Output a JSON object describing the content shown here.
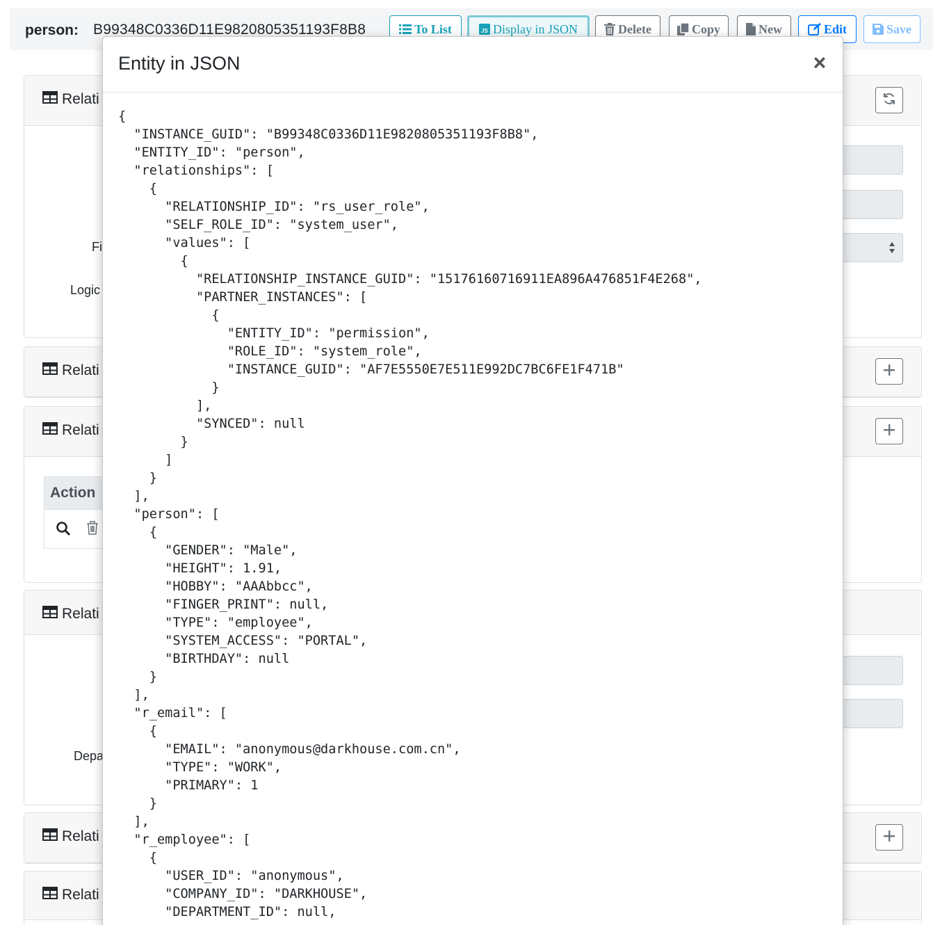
{
  "header": {
    "entity_label": "person:",
    "entity_guid": "B99348C0336D11E9820805351193F8B8",
    "buttons": {
      "to_list": "To List",
      "display_json": "Display in JSON",
      "delete": "Delete",
      "copy": "Copy",
      "new": "New",
      "edit": "Edit",
      "save": "Save"
    }
  },
  "background": {
    "card_title_partial": "Relati",
    "labels": {
      "first_name_partial": "Fi",
      "logic_partial": "Logic",
      "department_partial": "Depa"
    },
    "action_header": "Action"
  },
  "modal": {
    "title": "Entity in JSON",
    "close_symbol": "×",
    "json_text": "{\n  \"INSTANCE_GUID\": \"B99348C0336D11E9820805351193F8B8\",\n  \"ENTITY_ID\": \"person\",\n  \"relationships\": [\n    {\n      \"RELATIONSHIP_ID\": \"rs_user_role\",\n      \"SELF_ROLE_ID\": \"system_user\",\n      \"values\": [\n        {\n          \"RELATIONSHIP_INSTANCE_GUID\": \"15176160716911EA896A476851F4E268\",\n          \"PARTNER_INSTANCES\": [\n            {\n              \"ENTITY_ID\": \"permission\",\n              \"ROLE_ID\": \"system_role\",\n              \"INSTANCE_GUID\": \"AF7E5550E7E511E992DC7BC6FE1F471B\"\n            }\n          ],\n          \"SYNCED\": null\n        }\n      ]\n    }\n  ],\n  \"person\": [\n    {\n      \"GENDER\": \"Male\",\n      \"HEIGHT\": 1.91,\n      \"HOBBY\": \"AAAbbcc\",\n      \"FINGER_PRINT\": null,\n      \"TYPE\": \"employee\",\n      \"SYSTEM_ACCESS\": \"PORTAL\",\n      \"BIRTHDAY\": null\n    }\n  ],\n  \"r_email\": [\n    {\n      \"EMAIL\": \"anonymous@darkhouse.com.cn\",\n      \"TYPE\": \"WORK\",\n      \"PRIMARY\": 1\n    }\n  ],\n  \"r_employee\": [\n    {\n      \"USER_ID\": \"anonymous\",\n      \"COMPANY_ID\": \"DARKHOUSE\",\n      \"DEPARTMENT_ID\": null,"
  },
  "colors": {
    "info": "#17a2b8",
    "secondary": "#6c757d",
    "primary": "#007bff"
  },
  "icons": [
    "list-icon",
    "js-icon",
    "trash-icon",
    "copy-icon",
    "file-icon",
    "edit-icon",
    "save-icon",
    "refresh-icon",
    "plus-icon",
    "table-icon",
    "search-icon",
    "close-icon"
  ]
}
